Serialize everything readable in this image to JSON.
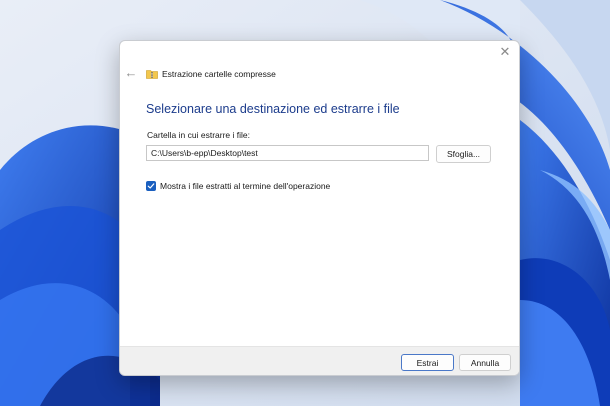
{
  "dialog": {
    "title": "Estrazione cartelle compresse",
    "close_symbol": "✕",
    "back_symbol": "←",
    "heading": "Selezionare una destinazione ed estrarre i file",
    "destination_label": "Cartella in cui estrarre i file:",
    "destination_value": "C:\\Users\\b-epp\\Desktop\\test",
    "browse_label": "Sfoglia...",
    "show_files_label": "Mostra i file estratti al termine dell'operazione",
    "show_files_checked": true,
    "extract_label": "Estrai",
    "cancel_label": "Annulla"
  },
  "icons": {
    "title_icon": "compressed-folder-icon",
    "back_icon": "arrow-left-icon",
    "close_icon": "close-icon",
    "check_icon": "checkmark-icon"
  },
  "colors": {
    "heading": "#1c3c8c",
    "checkbox": "#1a5fbf",
    "primary_border": "#4a78c8",
    "wallpaper_blue": "#1248c8"
  }
}
